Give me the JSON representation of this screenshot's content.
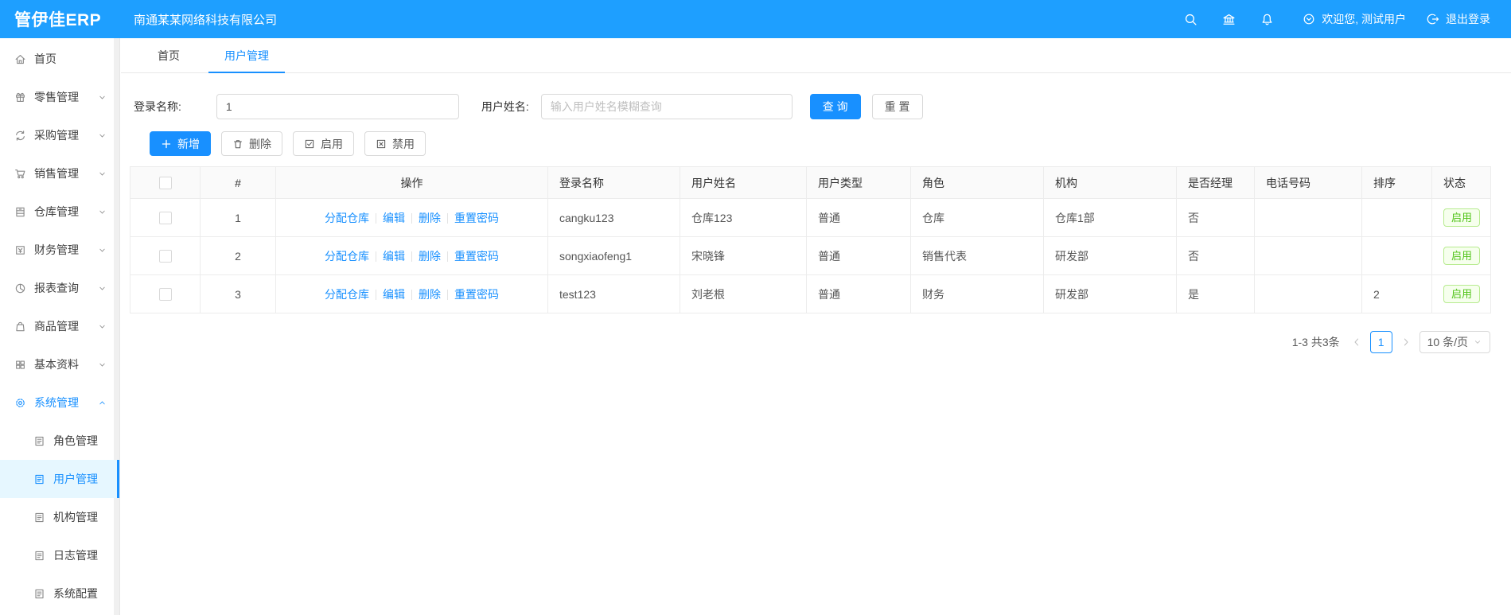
{
  "colors": {
    "header_bg": "#1e9fff",
    "primary": "#1890ff",
    "status_green": "#52c41a"
  },
  "header": {
    "logo": "管伊佳ERP",
    "company": "南通某某网络科技有限公司",
    "icons": [
      "search-icon",
      "bank-icon",
      "bell-icon"
    ],
    "welcome": "欢迎您, 测试用户",
    "logout": "退出登录"
  },
  "sidebar": {
    "items": [
      {
        "label": "首页",
        "icon": "home-icon",
        "chevron": null,
        "active": false
      },
      {
        "label": "零售管理",
        "icon": "gift-icon",
        "chevron": "down",
        "active": false
      },
      {
        "label": "采购管理",
        "icon": "sync-icon",
        "chevron": "down",
        "active": false
      },
      {
        "label": "销售管理",
        "icon": "cart-icon",
        "chevron": "down",
        "active": false
      },
      {
        "label": "仓库管理",
        "icon": "warehouse-icon",
        "chevron": "down",
        "active": false
      },
      {
        "label": "财务管理",
        "icon": "finance-icon",
        "chevron": "down",
        "active": false
      },
      {
        "label": "报表查询",
        "icon": "pie-icon",
        "chevron": "down",
        "active": false
      },
      {
        "label": "商品管理",
        "icon": "bag-icon",
        "chevron": "down",
        "active": false
      },
      {
        "label": "基本资料",
        "icon": "grid-icon",
        "chevron": "down",
        "active": false
      },
      {
        "label": "系统管理",
        "icon": "gear-icon",
        "chevron": "up",
        "active": true,
        "children": [
          {
            "label": "角色管理",
            "icon": "doc-icon",
            "active": false
          },
          {
            "label": "用户管理",
            "icon": "doc-icon",
            "active": true
          },
          {
            "label": "机构管理",
            "icon": "doc-icon",
            "active": false
          },
          {
            "label": "日志管理",
            "icon": "doc-icon",
            "active": false
          },
          {
            "label": "系统配置",
            "icon": "doc-icon",
            "active": false
          }
        ]
      }
    ]
  },
  "tabs": [
    {
      "label": "首页",
      "active": false
    },
    {
      "label": "用户管理",
      "active": true
    }
  ],
  "filter": {
    "login_label": "登录名称:",
    "login_value": "1",
    "name_label": "用户姓名:",
    "name_placeholder": "输入用户姓名模糊查询",
    "search": "查 询",
    "reset": "重 置"
  },
  "toolbar": {
    "add": "新增",
    "delete": "删除",
    "enable": "启用",
    "disable": "禁用"
  },
  "table": {
    "columns": [
      "#",
      "操作",
      "登录名称",
      "用户姓名",
      "用户类型",
      "角色",
      "机构",
      "是否经理",
      "电话号码",
      "排序",
      "状态"
    ],
    "actions": [
      "分配仓库",
      "编辑",
      "删除",
      "重置密码"
    ],
    "rows": [
      {
        "index": "1",
        "login": "cangku123",
        "name": "仓库123",
        "type": "普通",
        "role": "仓库",
        "org": "仓库1部",
        "manager": "否",
        "phone": "",
        "sort": "",
        "status": "启用"
      },
      {
        "index": "2",
        "login": "songxiaofeng1",
        "name": "宋晓锋",
        "type": "普通",
        "role": "销售代表",
        "org": "研发部",
        "manager": "否",
        "phone": "",
        "sort": "",
        "status": "启用"
      },
      {
        "index": "3",
        "login": "test123",
        "name": "刘老根",
        "type": "普通",
        "role": "财务",
        "org": "研发部",
        "manager": "是",
        "phone": "",
        "sort": "2",
        "status": "启用"
      }
    ]
  },
  "pagination": {
    "total": "1-3 共3条",
    "page": "1",
    "page_size": "10 条/页"
  }
}
